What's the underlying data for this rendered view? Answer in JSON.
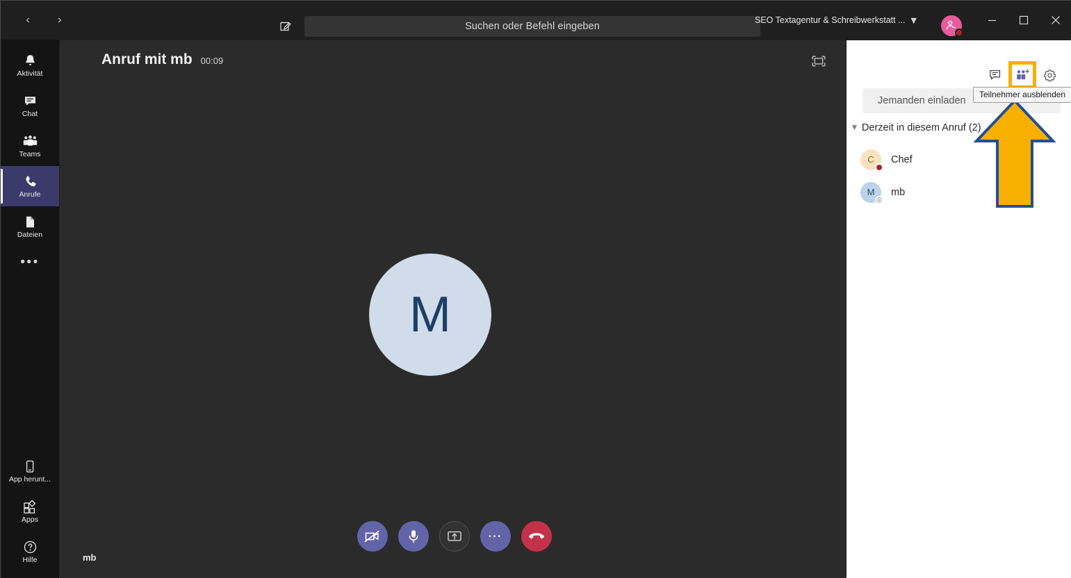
{
  "titlebar": {
    "back_icon": "chevron-left-icon",
    "forward_icon": "chevron-right-icon",
    "compose_icon": "compose-message-icon",
    "search_placeholder": "Suchen oder Befehl eingeben",
    "account_name": "SEO Textagentur & Schreibwerkstatt ...",
    "account_chevron": "chevron-down-icon",
    "avatar_color": "#e85c9e",
    "avatar_status": "busy",
    "avatar_status_color": "#a4262c",
    "minimize_label": "Minimieren",
    "maximize_label": "Maximieren",
    "close_label": "Schließen"
  },
  "sidebar": {
    "items": [
      {
        "label": "Aktivität",
        "icon": "bell-icon",
        "active": false
      },
      {
        "label": "Chat",
        "icon": "chat-icon",
        "active": false
      },
      {
        "label": "Teams",
        "icon": "teams-people-icon",
        "active": false
      },
      {
        "label": "Anrufe",
        "icon": "phone-icon",
        "active": true
      },
      {
        "label": "Dateien",
        "icon": "file-icon",
        "active": false
      }
    ],
    "more_label": "•••",
    "bottom_items": [
      {
        "label": "App herunt...",
        "icon": "mobile-device-icon"
      },
      {
        "label": "Apps",
        "icon": "apps-grid-icon"
      },
      {
        "label": "Hilfe",
        "icon": "help-question-icon"
      }
    ],
    "active_highlight": "#3b3a6b"
  },
  "stage": {
    "call_title": "Anruf mit mb",
    "call_duration": "00:09",
    "fullscreen_icon": "fullscreen-expand-icon",
    "big_avatar_initial": "M",
    "big_avatar_bg": "#d0dcea",
    "big_avatar_fg": "#1d3f66",
    "tile_name": "mb",
    "controls": [
      {
        "name": "camera-off-button",
        "icon": "camera-off-icon",
        "style": "purple"
      },
      {
        "name": "microphone-button",
        "icon": "microphone-icon",
        "style": "purple"
      },
      {
        "name": "share-screen-button",
        "icon": "share-screen-icon",
        "style": "dark"
      },
      {
        "name": "more-actions-button",
        "icon": "more-dots-icon",
        "style": "purple"
      },
      {
        "name": "hang-up-button",
        "icon": "hang-up-icon",
        "style": "red"
      }
    ],
    "purple": "#6264a7",
    "red": "#c4314b"
  },
  "panel": {
    "actions": [
      {
        "name": "show-conversation-button",
        "icon": "chat-bubble-icon",
        "highlighted": false
      },
      {
        "name": "hide-participants-button",
        "icon": "people-add-icon",
        "highlighted": true
      },
      {
        "name": "device-settings-button",
        "icon": "gear-icon",
        "highlighted": false
      }
    ],
    "highlight_color": "#F9AF00",
    "invite_placeholder": "Jemanden einladen",
    "section_title": "Derzeit in diesem Anruf (2)",
    "section_caret": "caret-down-icon",
    "participants": [
      {
        "name": "Chef",
        "initial": "C",
        "avatar_bg": "#f7e3bf",
        "avatar_fg": "#8a6d2f",
        "status": "busy",
        "status_color": "#a4262c",
        "status_icon": "busy-dot-icon"
      },
      {
        "name": "mb",
        "initial": "M",
        "avatar_bg": "#bcd3e8",
        "avatar_fg": "#2d4a68",
        "status": "offline",
        "status_color": "#8a8a8a",
        "status_icon": "offline-circle-icon"
      }
    ]
  },
  "annotations": {
    "tooltip_text": "Teilnehmer ausblenden",
    "arrow": {
      "name": "pointer-arrow",
      "fill": "#F9AF00",
      "stroke": "#1F4E9C",
      "direction": "up"
    }
  }
}
